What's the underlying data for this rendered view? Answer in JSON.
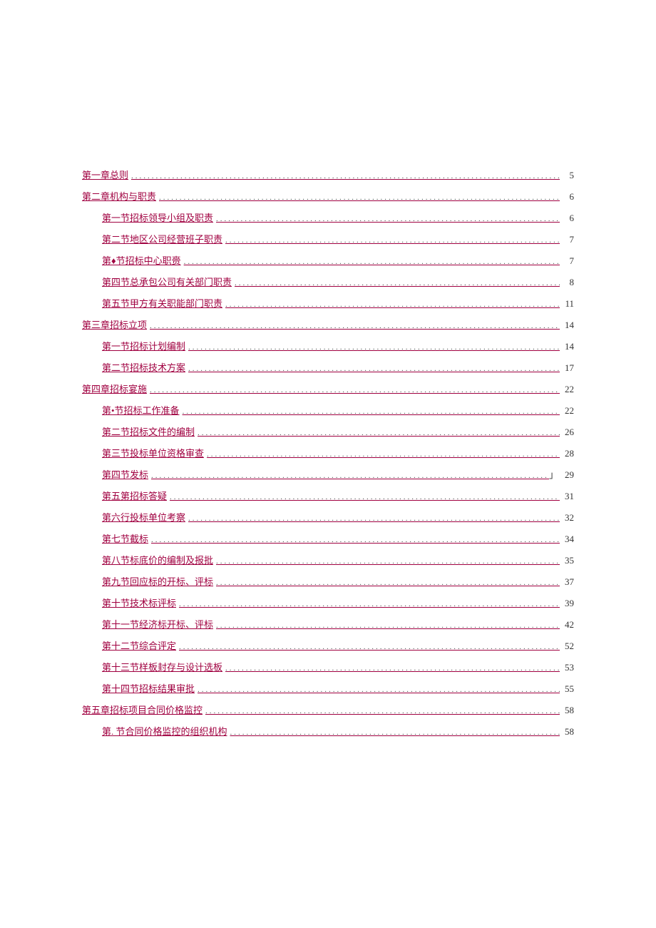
{
  "toc": [
    {
      "title": "第一章总则",
      "page": "5",
      "indent": false
    },
    {
      "title": "第二章机构与职责",
      "page": "6",
      "indent": false
    },
    {
      "title": "第一节招标领导小组及职责",
      "page": "6",
      "indent": true
    },
    {
      "title": "第二节地区公司经营班子职责",
      "page": "7",
      "indent": true
    },
    {
      "title": "第♦节招标中心职赍",
      "page": "7",
      "indent": true
    },
    {
      "title": "第四节总承包公司有关部门职责",
      "page": "8",
      "indent": true
    },
    {
      "title": "第五节甲方有关职能部门职责",
      "page": "11",
      "indent": true
    },
    {
      "title": "第三章招标立项",
      "page": "14",
      "indent": false
    },
    {
      "title": "第一节招标计划编制",
      "page": "14",
      "indent": true
    },
    {
      "title": "第二节招标技术方案",
      "page": "17",
      "indent": true
    },
    {
      "title": "第四章招标宴施",
      "page": "22",
      "indent": false
    },
    {
      "title": "第•节招标工作准备",
      "page": "22",
      "indent": true
    },
    {
      "title": "第二节招标文件的编制",
      "page": "26",
      "indent": true
    },
    {
      "title": "第三节投标单位资格审查",
      "page": "28",
      "indent": true
    },
    {
      "title": "第四节发标",
      "page": "29",
      "indent": true,
      "pagePrefix": "」"
    },
    {
      "title": "第五第招标答疑",
      "page": "31",
      "indent": true
    },
    {
      "title": "第六行投标单位考察",
      "page": "32",
      "indent": true
    },
    {
      "title": "第七节截标",
      "page": "34",
      "indent": true
    },
    {
      "title": "第八节标底价的编制及报批",
      "page": "35",
      "indent": true
    },
    {
      "title": "第九节回应标的开标、评标",
      "page": "37",
      "indent": true
    },
    {
      "title": "第十节技术标评标",
      "page": "39",
      "indent": true
    },
    {
      "title": "第十一节经济标开标、评标",
      "page": "42",
      "indent": true
    },
    {
      "title": "第十二节综合评定",
      "page": "52",
      "indent": true
    },
    {
      "title": "第十三节样板封存与设计选板",
      "page": "53",
      "indent": true
    },
    {
      "title": "第十四节招标结果审批",
      "page": "55",
      "indent": true
    },
    {
      "title": "第五章招标项目合同价格监控",
      "page": "58",
      "indent": false
    },
    {
      "title": "第. 节合同价格监控的组织机构",
      "page": "58",
      "indent": true
    }
  ]
}
